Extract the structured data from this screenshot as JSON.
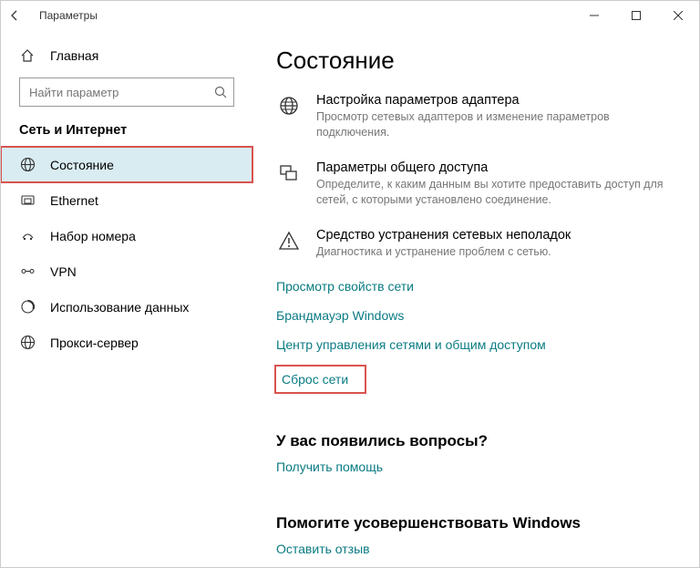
{
  "window": {
    "title": "Параметры"
  },
  "sidebar": {
    "home": "Главная",
    "search_placeholder": "Найти параметр",
    "section": "Сеть и Интернет",
    "items": [
      {
        "label": "Состояние"
      },
      {
        "label": "Ethernet"
      },
      {
        "label": "Набор номера"
      },
      {
        "label": "VPN"
      },
      {
        "label": "Использование данных"
      },
      {
        "label": "Прокси-сервер"
      }
    ]
  },
  "main": {
    "title": "Состояние",
    "settings": [
      {
        "label": "Настройка параметров адаптера",
        "desc": "Просмотр сетевых адаптеров и изменение параметров подключения."
      },
      {
        "label": "Параметры общего доступа",
        "desc": "Определите, к каким данным вы хотите предоставить доступ для сетей, с которыми установлено соединение."
      },
      {
        "label": "Средство устранения сетевых неполадок",
        "desc": "Диагностика и устранение проблем с сетью."
      }
    ],
    "links": [
      "Просмотр свойств сети",
      "Брандмауэр Windows",
      "Центр управления сетями и общим доступом",
      "Сброс сети"
    ],
    "help": {
      "heading": "У вас появились вопросы?",
      "link": "Получить помощь"
    },
    "feedback": {
      "heading": "Помогите усовершенствовать Windows",
      "link": "Оставить отзыв"
    }
  }
}
